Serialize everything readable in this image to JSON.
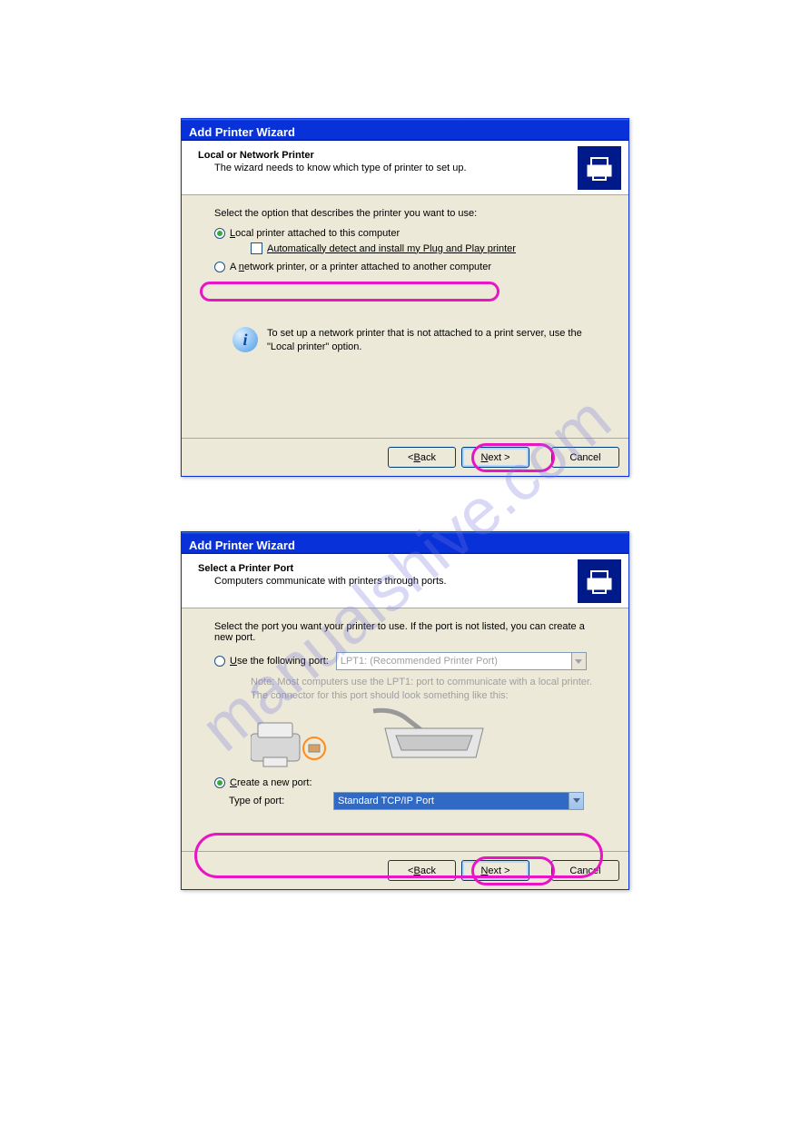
{
  "watermark": "manualshive.com",
  "dialog1": {
    "title": "Add Printer Wizard",
    "header_title": "Local or Network Printer",
    "header_sub": "The wizard needs to know which type of printer to set up.",
    "instruct": "Select the option that describes the printer you want to use:",
    "opt_local": "Local printer attached to this computer",
    "chk_auto": "Automatically detect and install my Plug and Play printer",
    "opt_network": "A network printer, or a printer attached to another computer",
    "info": "To set up a network printer that is not attached to a print server, use the \"Local printer\" option.",
    "btn_back_pre": "< ",
    "btn_back_u": "B",
    "btn_back_post": "ack",
    "btn_next_u": "N",
    "btn_next_post": "ext >",
    "btn_cancel": "Cancel"
  },
  "dialog2": {
    "title": "Add Printer Wizard",
    "header_title": "Select a Printer Port",
    "header_sub": "Computers communicate with printers through ports.",
    "instruct": "Select the port you want your printer to use.  If the port is not listed, you can create a new port.",
    "opt_use": "Use the following port:",
    "port_disabled": "LPT1: (Recommended Printer Port)",
    "note1": "Note: Most computers use the LPT1: port to communicate with a local printer.",
    "note2": "The connector for this port should look something like this:",
    "opt_create": "Create a new port:",
    "lbl_type": "Type of port:",
    "port_selected": "Standard TCP/IP Port",
    "btn_back_pre": "< ",
    "btn_back_u": "B",
    "btn_back_post": "ack",
    "btn_next_u": "N",
    "btn_next_post": "ext >",
    "btn_cancel": "Cancel"
  }
}
